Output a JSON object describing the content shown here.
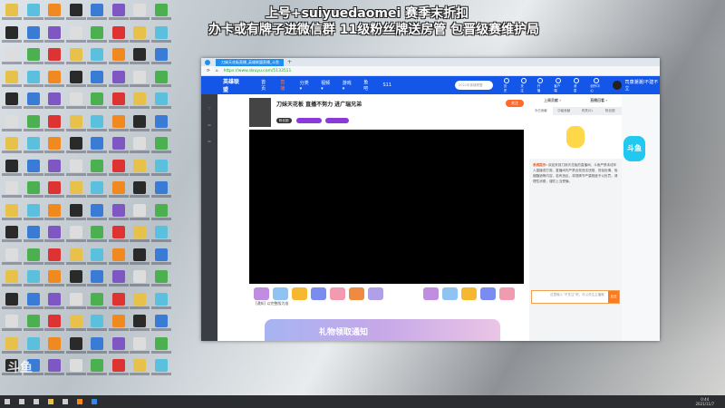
{
  "overlay": {
    "line1": "上号+suiyuedaomei 赛季末折扣",
    "line2": "办卡或有牌子进微信群 11级粉丝牌送房管 包晋级赛维护局"
  },
  "browser": {
    "tab_title": "刀妹天花板直播_英雄联盟直播_斗鱼",
    "url": "https://www.douyu.com/5133511"
  },
  "nav": {
    "logo": "英雄联盟",
    "items": [
      "首页",
      "直播",
      "分类▾",
      "视频▾",
      "游戏▾",
      "鱼吧",
      "S11"
    ],
    "search_placeholder": "2021年英雄联盟",
    "icons": [
      "历史",
      "关注",
      "开播",
      "客户端",
      "消息",
      "创作中心"
    ],
    "username": "司康潮潮/不建不立"
  },
  "stream": {
    "title": "刀妹天花板 直播不努力 进广瑞兄弟",
    "follow": "关注",
    "badge": "粉丝团"
  },
  "notice": "[通知] 以完整版为准",
  "banner": "礼物领取通知",
  "right": {
    "tabs": [
      "上周贡献 ›",
      "直播回看 ›"
    ],
    "subtabs": [
      "今日贡献",
      "中级贡献",
      "贵宾(0)",
      "粉丝团"
    ],
    "sys_label": "系统提示:",
    "sys_text": "欢迎来到刀妹天花板的直播间，斗鱼严禁未成年人直播或打赏。直播间内严禁出现违法违规、低俗色情、吸烟酗酒等内容，若有违反，将视情节严重程度予以处罚。请理性消费，谨防上当受骗。",
    "chat_placeholder": "这里输入“不关注”吧，可以关注主播哦",
    "send": "发送"
  },
  "side": {
    "mascot": "斗鱼"
  },
  "taskbar": {
    "time": "0:44",
    "date": "2021/11/7"
  },
  "watermark": "斗鱼"
}
